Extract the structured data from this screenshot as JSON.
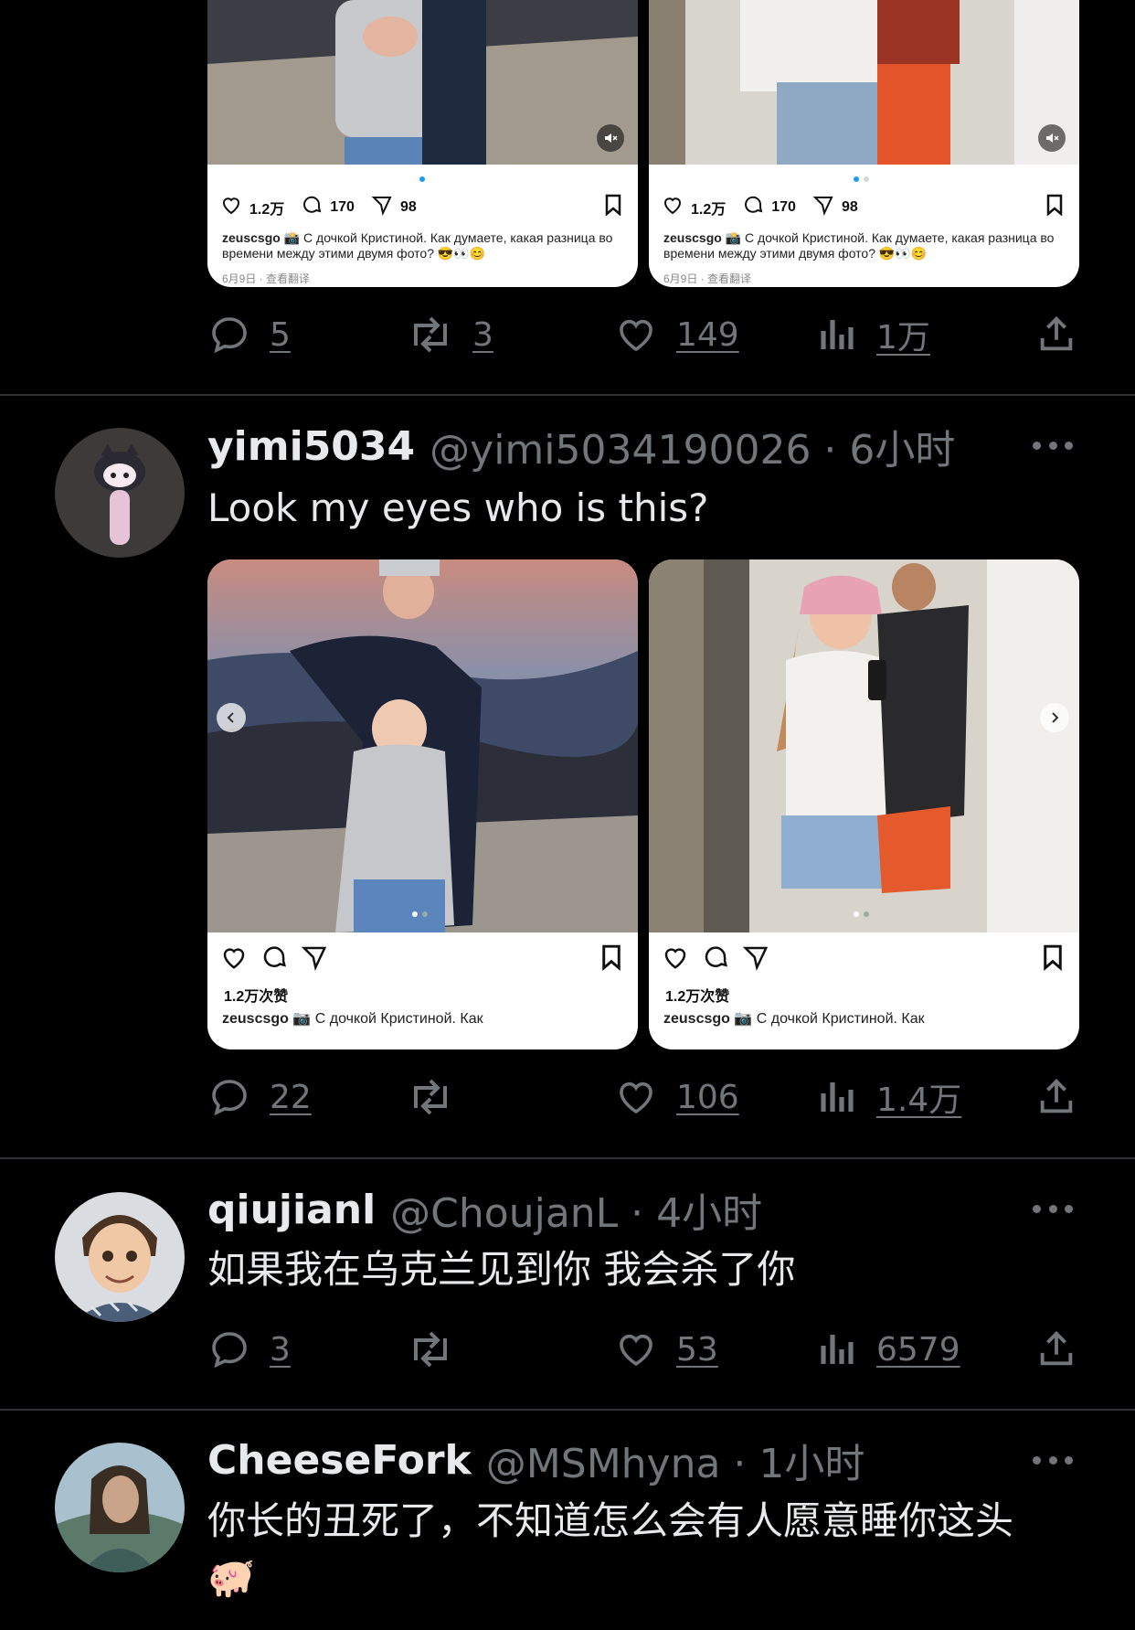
{
  "tweet_prev": {
    "media": [
      {
        "likes": "1.2万",
        "comments": "170",
        "shares": "98",
        "caption_user": "zeuscsgo",
        "caption": "📸 С дочкой Кристиной. Как думаете, какая разница во времени между этими двумя фото? 😎👀😊",
        "meta": "6月9日 · 查看翻译"
      },
      {
        "likes": "1.2万",
        "comments": "170",
        "shares": "98",
        "caption_user": "zeuscsgo",
        "caption": "📸 С дочкой Кристиной. Как думаете, какая разница во времени между этими двумя фото? 😎👀😊",
        "meta": "6月9日 · 查看翻译"
      }
    ],
    "actions": {
      "replies": "5",
      "retweets": "3",
      "likes": "149",
      "views": "1万"
    }
  },
  "tweet1": {
    "name": "yimi5034",
    "handle": "@yimi5034190026 · 6小时",
    "text": "Look my eyes who is this?",
    "media": [
      {
        "likes_label": "1.2万次赞",
        "caption_user": "zeuscsgo",
        "caption": "📷 С дочкой Кристиной. Как"
      },
      {
        "likes_label": "1.2万次赞",
        "caption_user": "zeuscsgo",
        "caption": "📷 С дочкой Кристиной. Как"
      }
    ],
    "actions": {
      "replies": "22",
      "retweets": "",
      "likes": "106",
      "views": "1.4万"
    }
  },
  "tweet2": {
    "name": "qiujianl",
    "handle": "@ChoujanL · 4小时",
    "text": "如果我在乌克兰见到你 我会杀了你",
    "actions": {
      "replies": "3",
      "retweets": "",
      "likes": "53",
      "views": "6579"
    }
  },
  "tweet3": {
    "name": "CheeseFork",
    "handle": "@MSMhyna · 1小时",
    "text": "你长的丑死了，不知道怎么会有人愿意睡你这头🐖"
  },
  "colors": {
    "background": "#000000",
    "text": "#e7e9ea",
    "muted": "#71767b",
    "divider": "#2f3336",
    "accent": "#1d9bf0"
  },
  "icons": [
    "reply-icon",
    "retweet-icon",
    "like-icon",
    "views-icon",
    "share-icon",
    "more-icon",
    "bookmark-icon",
    "send-icon",
    "mute-icon"
  ]
}
